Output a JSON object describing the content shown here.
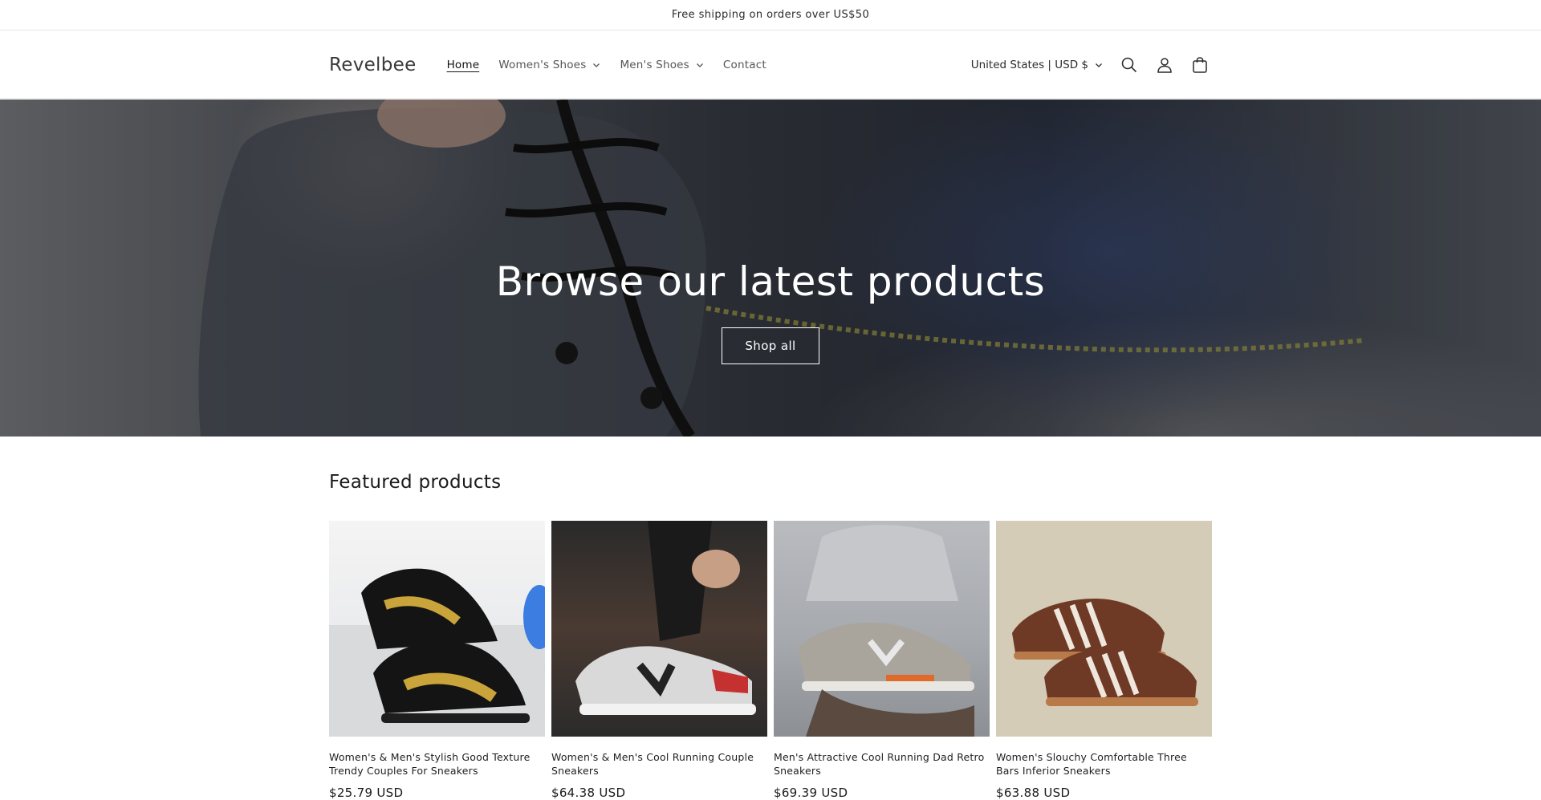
{
  "announcement": {
    "text": "Free shipping on orders over US$50"
  },
  "header": {
    "logo": "Revelbee",
    "nav": [
      {
        "label": "Home",
        "active": true,
        "has_dropdown": false
      },
      {
        "label": "Women's Shoes",
        "active": false,
        "has_dropdown": true
      },
      {
        "label": "Men's Shoes",
        "active": false,
        "has_dropdown": true
      },
      {
        "label": "Contact",
        "active": false,
        "has_dropdown": false
      }
    ],
    "locale": "United States | USD $",
    "icons": [
      "search-icon",
      "account-icon",
      "cart-icon"
    ]
  },
  "hero": {
    "title": "Browse our latest products",
    "button_label": "Shop all"
  },
  "featured": {
    "title": "Featured products",
    "products": [
      {
        "title": "Women's & Men's Stylish Good Texture Trendy Couples For Sneakers",
        "price": "$25.79 USD"
      },
      {
        "title": "Women's & Men's Cool Running Couple Sneakers",
        "price": "$64.38 USD"
      },
      {
        "title": "Men's Attractive Cool Running Dad Retro Sneakers",
        "price": "$69.39 USD"
      },
      {
        "title": "Women's Slouchy Comfortable Three Bars Inferior Sneakers",
        "price": "$63.88 USD"
      }
    ]
  },
  "colors": {
    "text": "#121212",
    "border": "#e6e6e6",
    "hero_overlay": "#000000"
  }
}
